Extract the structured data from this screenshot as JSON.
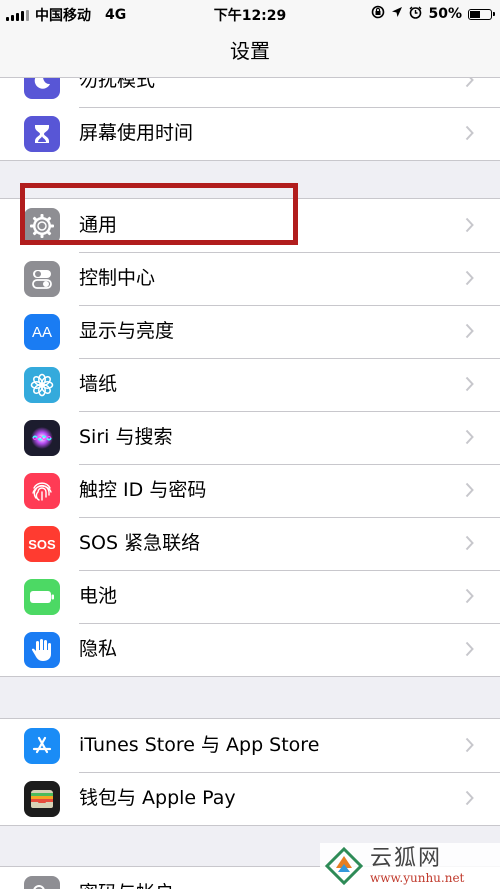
{
  "status_bar": {
    "carrier": "中国移动",
    "network": "4G",
    "time": "下午12:29",
    "battery_percent": "50%",
    "battery_level": 0.5
  },
  "nav": {
    "title": "设置"
  },
  "groups": [
    {
      "rows": [
        {
          "label": "勿扰模式",
          "icon": "moon-icon",
          "color": "#5856d6"
        },
        {
          "label": "屏幕使用时间",
          "icon": "hourglass-icon",
          "color": "#5856d6"
        }
      ]
    },
    {
      "rows": [
        {
          "label": "通用",
          "icon": "gear-icon",
          "color": "#8e8e93"
        },
        {
          "label": "控制中心",
          "icon": "toggle-icon",
          "color": "#8e8e93"
        },
        {
          "label": "显示与亮度",
          "icon": "text-size-icon",
          "glyph": "AA",
          "color": "#1a7cf3"
        },
        {
          "label": "墙纸",
          "icon": "flower-icon",
          "color": "#34aadc"
        },
        {
          "label": "Siri 与搜索",
          "icon": "siri-icon",
          "color": "#1c1c2e"
        },
        {
          "label": "触控 ID 与密码",
          "icon": "fingerprint-icon",
          "color": "#ff3b55"
        },
        {
          "label": "SOS 紧急联络",
          "icon": "sos-icon",
          "glyph": "SOS",
          "color": "#ff3b30"
        },
        {
          "label": "电池",
          "icon": "battery-icon",
          "color": "#4cd964"
        },
        {
          "label": "隐私",
          "icon": "hand-icon",
          "color": "#1a7cf3"
        }
      ]
    },
    {
      "rows": [
        {
          "label": "iTunes Store 与 App Store",
          "icon": "app-store-icon",
          "color": "#1a8cf6"
        },
        {
          "label": "钱包与 Apple Pay",
          "icon": "wallet-icon",
          "color": "#1c1c1c"
        }
      ]
    },
    {
      "rows": [
        {
          "label": "密码与帐户",
          "icon": "key-icon",
          "color": "#8e8e93"
        }
      ]
    }
  ],
  "watermark": {
    "text": "云狐网",
    "url": "www.yunhu.net"
  }
}
